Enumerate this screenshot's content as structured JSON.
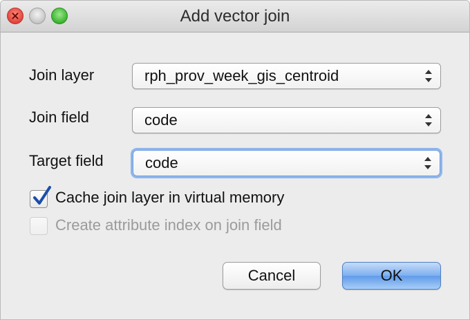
{
  "window": {
    "title": "Add vector join"
  },
  "form": {
    "join_layer": {
      "label": "Join layer",
      "value": "rph_prov_week_gis_centroid"
    },
    "join_field": {
      "label": "Join field",
      "value": "code"
    },
    "target_field": {
      "label": "Target field",
      "value": "code"
    },
    "cache_option": {
      "label": "Cache join layer in virtual memory",
      "checked": true
    },
    "index_option": {
      "label": "Create attribute index on join field",
      "checked": false,
      "enabled": false
    }
  },
  "buttons": {
    "cancel": "Cancel",
    "ok": "OK"
  },
  "colors": {
    "window_bg": "#ececec",
    "focus_ring": "#8fb6ec",
    "checkmark": "#1a4fa8",
    "ok_button": "#7daff1"
  }
}
